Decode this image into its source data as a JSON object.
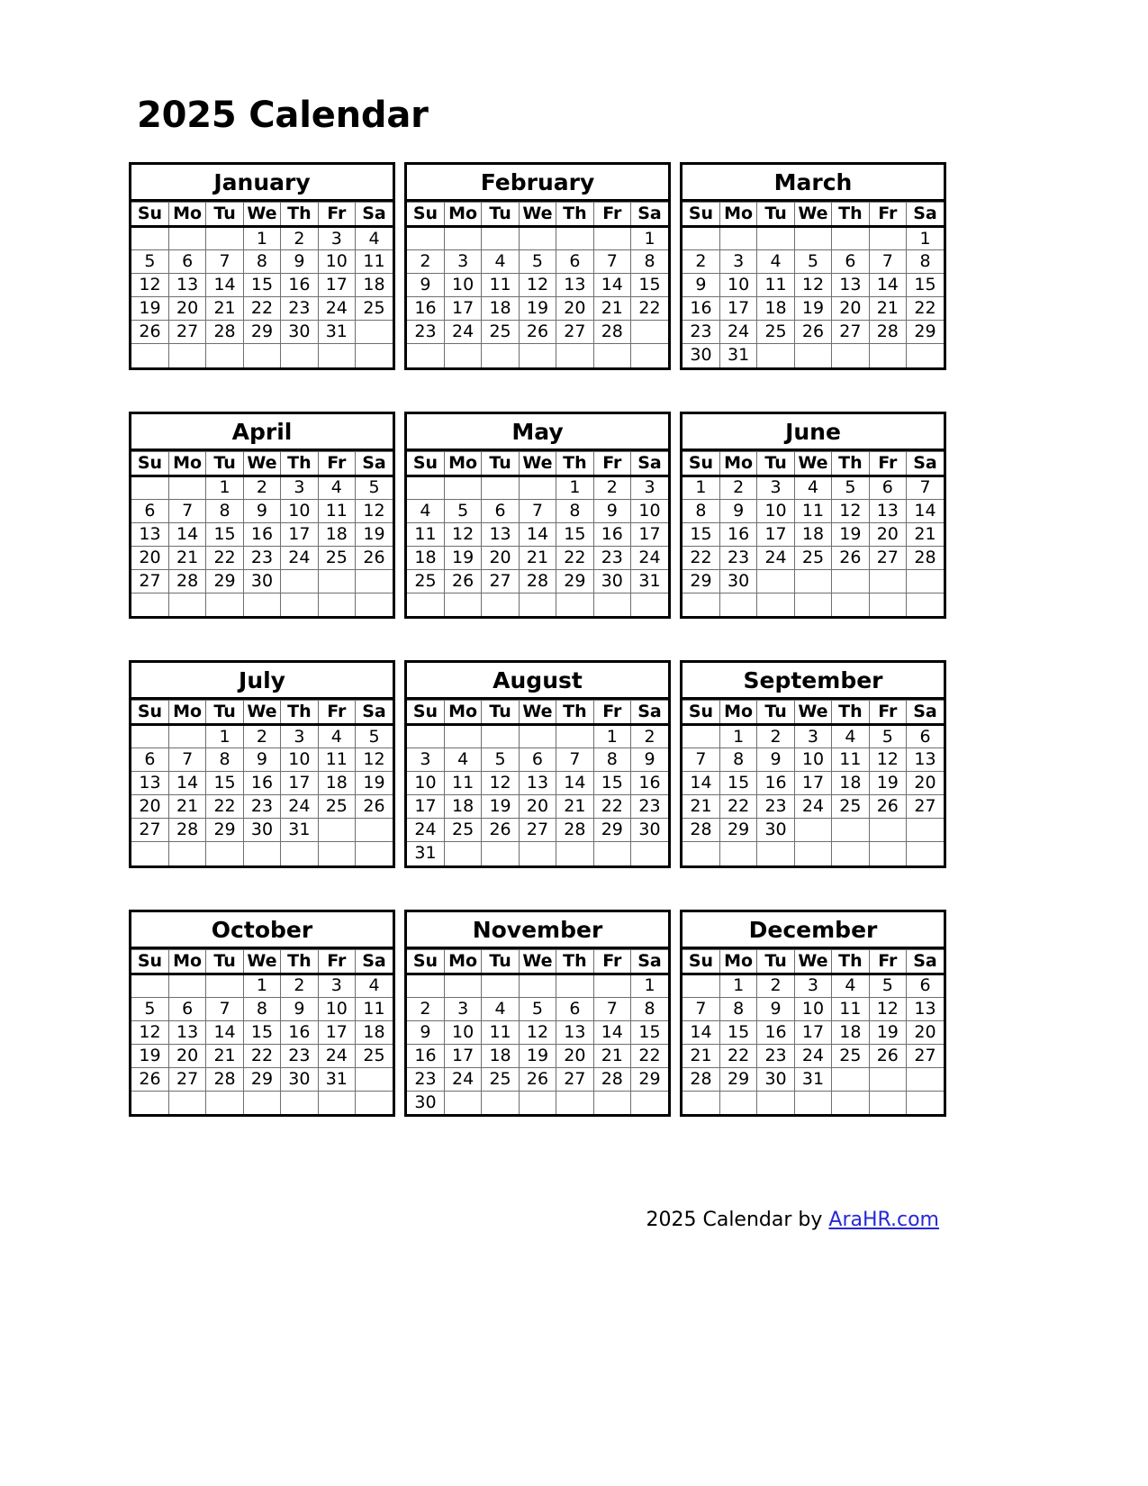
{
  "page": {
    "title": "2025 Calendar",
    "year": "2025"
  },
  "weekday_headers": [
    "Su",
    "Mo",
    "Tu",
    "We",
    "Th",
    "Fr",
    "Sa"
  ],
  "footer": {
    "prefix": "2025  Calendar by ",
    "link_label": "AraHR.com",
    "link_color": "#2727d8"
  },
  "months": [
    {
      "name": "January",
      "weeks": [
        [
          "",
          "",
          "",
          "1",
          "2",
          "3",
          "4"
        ],
        [
          "5",
          "6",
          "7",
          "8",
          "9",
          "10",
          "11"
        ],
        [
          "12",
          "13",
          "14",
          "15",
          "16",
          "17",
          "18"
        ],
        [
          "19",
          "20",
          "21",
          "22",
          "23",
          "24",
          "25"
        ],
        [
          "26",
          "27",
          "28",
          "29",
          "30",
          "31",
          ""
        ],
        [
          "",
          "",
          "",
          "",
          "",
          "",
          ""
        ]
      ]
    },
    {
      "name": "February",
      "weeks": [
        [
          "",
          "",
          "",
          "",
          "",
          "",
          "1"
        ],
        [
          "2",
          "3",
          "4",
          "5",
          "6",
          "7",
          "8"
        ],
        [
          "9",
          "10",
          "11",
          "12",
          "13",
          "14",
          "15"
        ],
        [
          "16",
          "17",
          "18",
          "19",
          "20",
          "21",
          "22"
        ],
        [
          "23",
          "24",
          "25",
          "26",
          "27",
          "28",
          ""
        ],
        [
          "",
          "",
          "",
          "",
          "",
          "",
          ""
        ]
      ]
    },
    {
      "name": "March",
      "weeks": [
        [
          "",
          "",
          "",
          "",
          "",
          "",
          "1"
        ],
        [
          "2",
          "3",
          "4",
          "5",
          "6",
          "7",
          "8"
        ],
        [
          "9",
          "10",
          "11",
          "12",
          "13",
          "14",
          "15"
        ],
        [
          "16",
          "17",
          "18",
          "19",
          "20",
          "21",
          "22"
        ],
        [
          "23",
          "24",
          "25",
          "26",
          "27",
          "28",
          "29"
        ],
        [
          "30",
          "31",
          "",
          "",
          "",
          "",
          ""
        ]
      ]
    },
    {
      "name": "April",
      "weeks": [
        [
          "",
          "",
          "1",
          "2",
          "3",
          "4",
          "5"
        ],
        [
          "6",
          "7",
          "8",
          "9",
          "10",
          "11",
          "12"
        ],
        [
          "13",
          "14",
          "15",
          "16",
          "17",
          "18",
          "19"
        ],
        [
          "20",
          "21",
          "22",
          "23",
          "24",
          "25",
          "26"
        ],
        [
          "27",
          "28",
          "29",
          "30",
          "",
          "",
          ""
        ],
        [
          "",
          "",
          "",
          "",
          "",
          "",
          ""
        ]
      ]
    },
    {
      "name": "May",
      "weeks": [
        [
          "",
          "",
          "",
          "",
          "1",
          "2",
          "3"
        ],
        [
          "4",
          "5",
          "6",
          "7",
          "8",
          "9",
          "10"
        ],
        [
          "11",
          "12",
          "13",
          "14",
          "15",
          "16",
          "17"
        ],
        [
          "18",
          "19",
          "20",
          "21",
          "22",
          "23",
          "24"
        ],
        [
          "25",
          "26",
          "27",
          "28",
          "29",
          "30",
          "31"
        ],
        [
          "",
          "",
          "",
          "",
          "",
          "",
          ""
        ]
      ]
    },
    {
      "name": "June",
      "weeks": [
        [
          "1",
          "2",
          "3",
          "4",
          "5",
          "6",
          "7"
        ],
        [
          "8",
          "9",
          "10",
          "11",
          "12",
          "13",
          "14"
        ],
        [
          "15",
          "16",
          "17",
          "18",
          "19",
          "20",
          "21"
        ],
        [
          "22",
          "23",
          "24",
          "25",
          "26",
          "27",
          "28"
        ],
        [
          "29",
          "30",
          "",
          "",
          "",
          "",
          ""
        ],
        [
          "",
          "",
          "",
          "",
          "",
          "",
          ""
        ]
      ]
    },
    {
      "name": "July",
      "weeks": [
        [
          "",
          "",
          "1",
          "2",
          "3",
          "4",
          "5"
        ],
        [
          "6",
          "7",
          "8",
          "9",
          "10",
          "11",
          "12"
        ],
        [
          "13",
          "14",
          "15",
          "16",
          "17",
          "18",
          "19"
        ],
        [
          "20",
          "21",
          "22",
          "23",
          "24",
          "25",
          "26"
        ],
        [
          "27",
          "28",
          "29",
          "30",
          "31",
          "",
          ""
        ],
        [
          "",
          "",
          "",
          "",
          "",
          "",
          ""
        ]
      ]
    },
    {
      "name": "August",
      "weeks": [
        [
          "",
          "",
          "",
          "",
          "",
          "1",
          "2"
        ],
        [
          "3",
          "4",
          "5",
          "6",
          "7",
          "8",
          "9"
        ],
        [
          "10",
          "11",
          "12",
          "13",
          "14",
          "15",
          "16"
        ],
        [
          "17",
          "18",
          "19",
          "20",
          "21",
          "22",
          "23"
        ],
        [
          "24",
          "25",
          "26",
          "27",
          "28",
          "29",
          "30"
        ],
        [
          "31",
          "",
          "",
          "",
          "",
          "",
          ""
        ]
      ]
    },
    {
      "name": "September",
      "weeks": [
        [
          "",
          "1",
          "2",
          "3",
          "4",
          "5",
          "6"
        ],
        [
          "7",
          "8",
          "9",
          "10",
          "11",
          "12",
          "13"
        ],
        [
          "14",
          "15",
          "16",
          "17",
          "18",
          "19",
          "20"
        ],
        [
          "21",
          "22",
          "23",
          "24",
          "25",
          "26",
          "27"
        ],
        [
          "28",
          "29",
          "30",
          "",
          "",
          "",
          ""
        ],
        [
          "",
          "",
          "",
          "",
          "",
          "",
          ""
        ]
      ]
    },
    {
      "name": "October",
      "weeks": [
        [
          "",
          "",
          "",
          "1",
          "2",
          "3",
          "4"
        ],
        [
          "5",
          "6",
          "7",
          "8",
          "9",
          "10",
          "11"
        ],
        [
          "12",
          "13",
          "14",
          "15",
          "16",
          "17",
          "18"
        ],
        [
          "19",
          "20",
          "21",
          "22",
          "23",
          "24",
          "25"
        ],
        [
          "26",
          "27",
          "28",
          "29",
          "30",
          "31",
          ""
        ],
        [
          "",
          "",
          "",
          "",
          "",
          "",
          ""
        ]
      ]
    },
    {
      "name": "November",
      "weeks": [
        [
          "",
          "",
          "",
          "",
          "",
          "",
          "1"
        ],
        [
          "2",
          "3",
          "4",
          "5",
          "6",
          "7",
          "8"
        ],
        [
          "9",
          "10",
          "11",
          "12",
          "13",
          "14",
          "15"
        ],
        [
          "16",
          "17",
          "18",
          "19",
          "20",
          "21",
          "22"
        ],
        [
          "23",
          "24",
          "25",
          "26",
          "27",
          "28",
          "29"
        ],
        [
          "30",
          "",
          "",
          "",
          "",
          "",
          ""
        ]
      ]
    },
    {
      "name": "December",
      "weeks": [
        [
          "",
          "1",
          "2",
          "3",
          "4",
          "5",
          "6"
        ],
        [
          "7",
          "8",
          "9",
          "10",
          "11",
          "12",
          "13"
        ],
        [
          "14",
          "15",
          "16",
          "17",
          "18",
          "19",
          "20"
        ],
        [
          "21",
          "22",
          "23",
          "24",
          "25",
          "26",
          "27"
        ],
        [
          "28",
          "29",
          "30",
          "31",
          "",
          "",
          ""
        ],
        [
          "",
          "",
          "",
          "",
          "",
          "",
          ""
        ]
      ]
    }
  ]
}
